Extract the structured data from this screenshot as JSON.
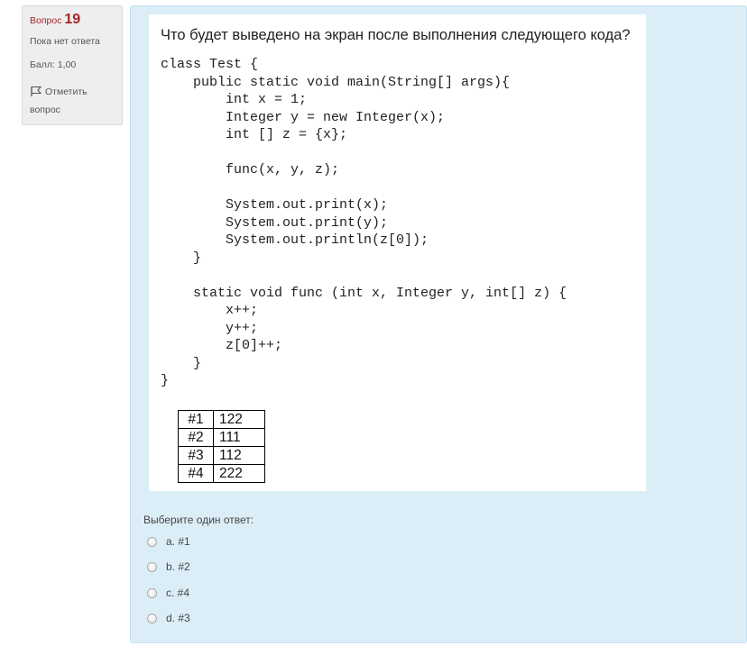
{
  "info": {
    "question_label": "Вопрос",
    "question_number": "19",
    "state": "Пока нет ответа",
    "grade": "Балл: 1,00",
    "flag_label_line1": "Отметить",
    "flag_label_line2": "вопрос"
  },
  "question": {
    "text": "Что будет выведено на экран после выполнения следующего кода?",
    "code_lines": [
      "class Test {",
      "    public static void main(String[] args){",
      "        int x = 1;",
      "        Integer y = new Integer(x);",
      "        int [] z = {x};",
      "",
      "        func(x, y, z);",
      "",
      "        System.out.print(x);",
      "        System.out.print(y);",
      "        System.out.println(z[0]);",
      "    }",
      "",
      "    static void func (int x, Integer y, int[] z) {",
      "        x++;",
      "        y++;",
      "        z[0]++;",
      "    }",
      "}"
    ],
    "options_table": [
      [
        "#1",
        "122"
      ],
      [
        "#2",
        "111"
      ],
      [
        "#3",
        "112"
      ],
      [
        "#4",
        "222"
      ]
    ]
  },
  "answer": {
    "prompt": "Выберите один ответ:",
    "choices": [
      {
        "label": "a. #1"
      },
      {
        "label": "b. #2"
      },
      {
        "label": "c. #4"
      },
      {
        "label": "d. #3"
      }
    ]
  }
}
